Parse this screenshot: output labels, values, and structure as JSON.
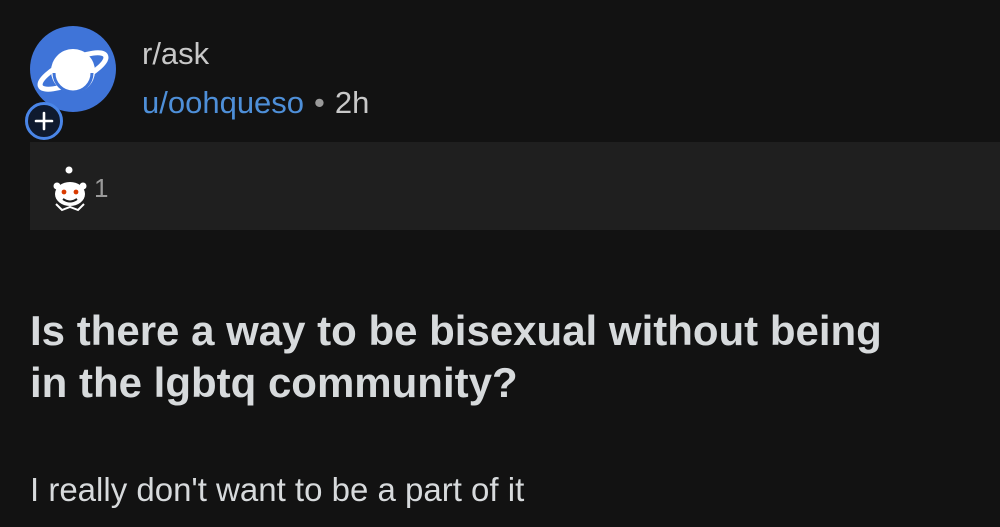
{
  "post": {
    "subreddit": "r/ask",
    "author": "u/oohqueso",
    "separator": "•",
    "time_ago": "2h",
    "title_line1": "Is there a way to be bisexual without being",
    "title_line2": "in the lgbtq community?",
    "body": "I really don't want to be a part of it"
  },
  "avatar": {
    "icon": "planet-icon",
    "color": "#3f74d8"
  },
  "join": {
    "icon": "plus-icon",
    "color": "#4a86e8"
  },
  "awards": {
    "icon": "snoo-award-icon",
    "count": "1"
  },
  "colors": {
    "background": "#121212",
    "award_bar": "#1f1f1f",
    "author_link": "#4e8fd8",
    "text": "#d7dadc"
  }
}
